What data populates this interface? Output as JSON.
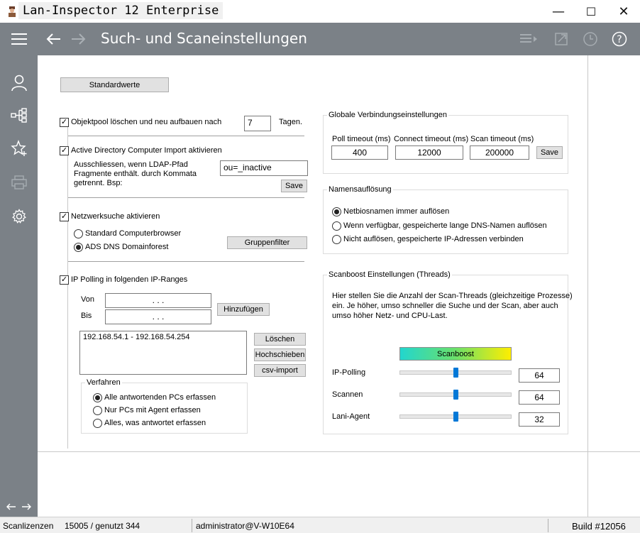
{
  "window": {
    "title": "Lan-Inspector 12 Enterprise",
    "minimize": "—",
    "maximize": "☐",
    "close": "✕"
  },
  "header": {
    "title": "Such- und Scaneinstellungen"
  },
  "defaults_button": "Standardwerte",
  "objectpool": {
    "label": "Objektpool löschen und neu aufbauen nach",
    "checked": true,
    "days_value": "7",
    "days_unit": "Tagen."
  },
  "active_directory": {
    "label": "Active Directory Computer Import aktivieren",
    "checked": true,
    "exclude_line1": "Ausschliessen, wenn LDAP-Pfad",
    "exclude_line2": "Fragmente enthält. durch Kommata",
    "exclude_line3": "getrennt. Bsp:",
    "exclude_value": "ou=_inactive",
    "save_label": "Save"
  },
  "network_search": {
    "label": "Netzwerksuche aktivieren",
    "checked": true,
    "option1": "Standard Computerbrowser",
    "option2": "ADS DNS Domainforest",
    "selected": "option2",
    "group_filter_label": "Gruppenfilter"
  },
  "ip_polling": {
    "label": "IP Polling in folgenden IP-Ranges",
    "checked": true,
    "from_label": "Von",
    "to_label": "Bis",
    "from_value": ".        .        .",
    "to_value": ".        .        .",
    "add_label": "Hinzufügen",
    "ranges": [
      "192.168.54.1  -  192.168.54.254"
    ],
    "delete_label": "Löschen",
    "move_up_label": "Hochschieben",
    "csv_import_label": "csv-import",
    "method_title": "Verfahren",
    "method_option1": "Alle antwortenden PCs erfassen",
    "method_option2": "Nur PCs mit Agent erfassen",
    "method_option3": "Alles, was antwortet erfassen",
    "method_selected": "option1"
  },
  "global_connection": {
    "title": "Globale Verbindungseinstellungen",
    "poll_timeout_label": "Poll timeout (ms)",
    "poll_timeout_value": "400",
    "connect_timeout_label": "Connect timeout (ms)",
    "connect_timeout_value": "12000",
    "scan_timeout_label": "Scan timeout (ms)",
    "scan_timeout_value": "200000",
    "save_label": "Save"
  },
  "name_resolution": {
    "title": "Namensauflösung",
    "option1": "Netbiosnamen immer auflösen",
    "option2": "Wenn verfügbar, gespeicherte lange DNS-Namen auflösen",
    "option3": "Nicht auflösen, gespeicherte IP-Adressen verbinden",
    "selected": "option1"
  },
  "scanboost": {
    "title": "Scanboost Einstellungen (Threads)",
    "desc_line1": "Hier stellen Sie die Anzahl der Scan-Threads (gleichzeitige Prozesse)",
    "desc_line2": "ein. Je höher, umso schneller die Suche und der Scan, aber auch",
    "desc_line3": "umso höher Netz- und CPU-Last.",
    "bar_label": "Scanboost",
    "ip_polling_label": "IP-Polling",
    "ip_polling_value": "64",
    "ip_polling_level": 0.5,
    "scan_label": "Scannen",
    "scan_value": "64",
    "scan_level": 0.5,
    "agent_label": "Lani-Agent",
    "agent_value": "32",
    "agent_level": 0.5
  },
  "statusbar": {
    "licenses_label": "Scanlizenzen",
    "licenses_value": "15005 / genutzt 344",
    "user": "administrator@V-W10E64",
    "build": "Build #12056"
  },
  "colors": {
    "header_bg": "#7b8187",
    "accent": "#0078d7"
  }
}
